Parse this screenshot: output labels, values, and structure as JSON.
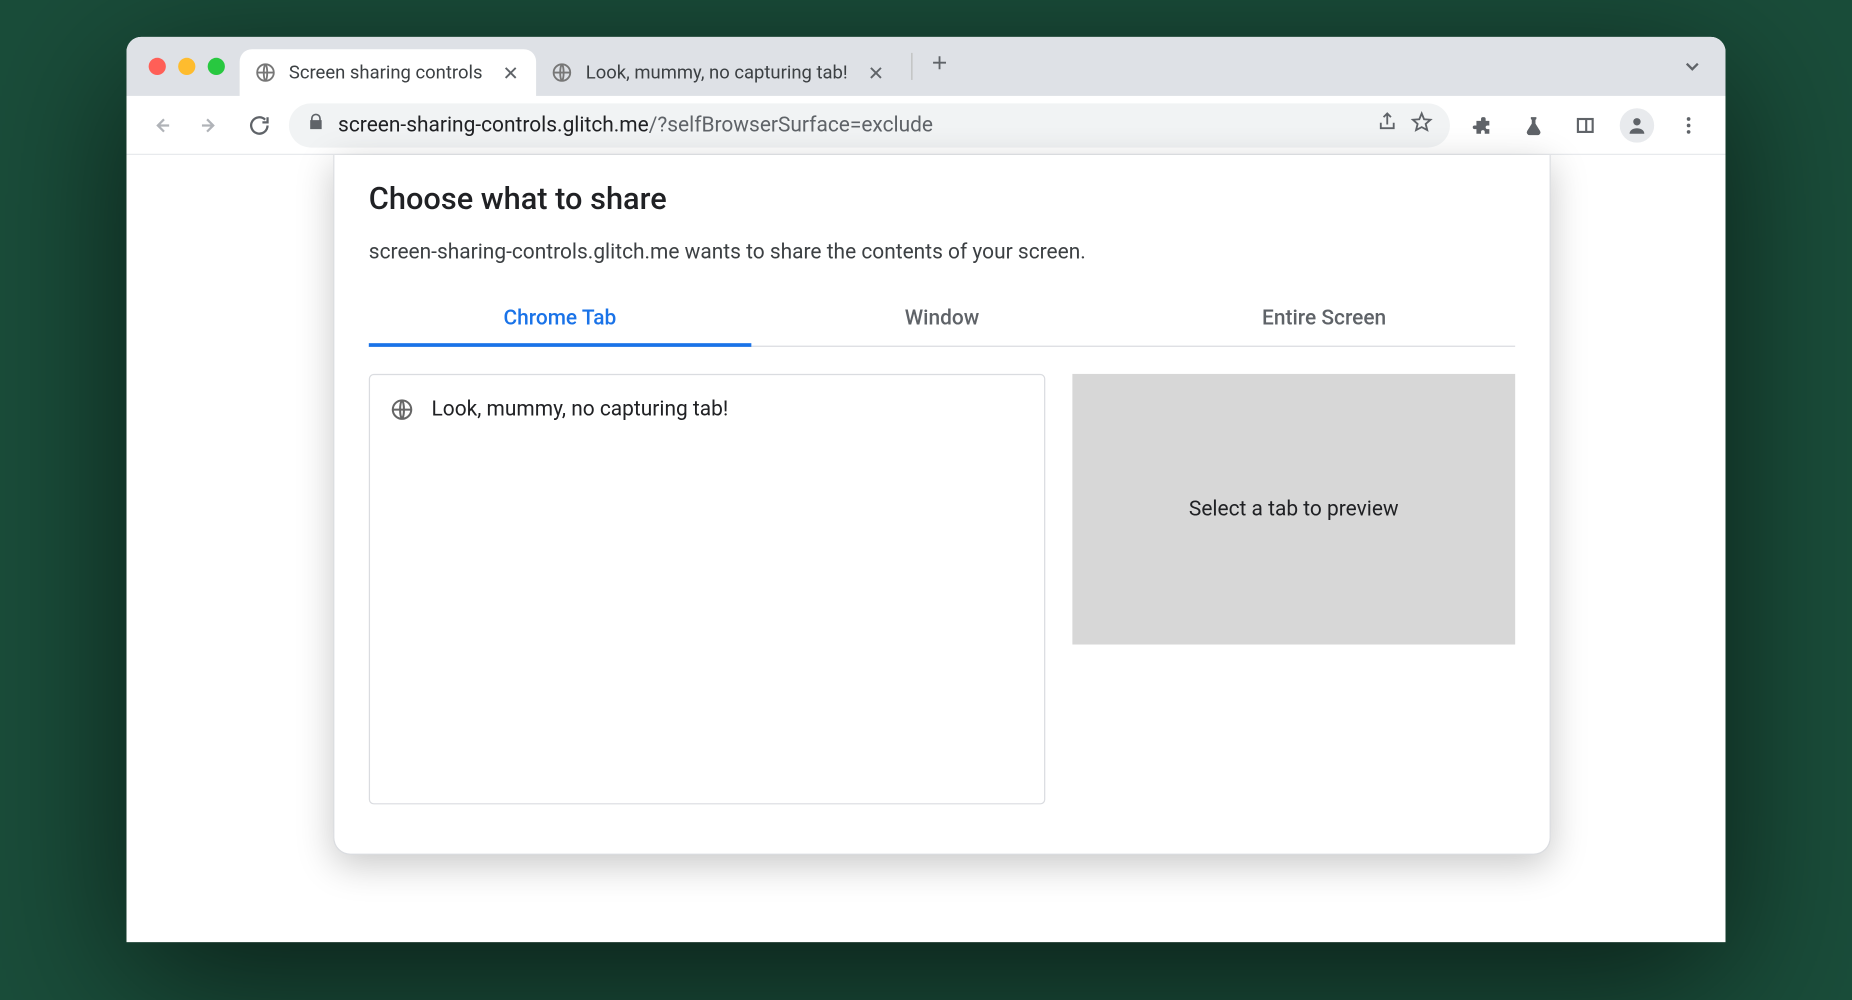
{
  "browser": {
    "tabs": [
      {
        "title": "Screen sharing controls",
        "active": true
      },
      {
        "title": "Look, mummy, no capturing tab!",
        "active": false
      }
    ],
    "url_host": "screen-sharing-controls.glitch.me",
    "url_path": "/?selfBrowserSurface=exclude"
  },
  "picker": {
    "title": "Choose what to share",
    "subtitle": "screen-sharing-controls.glitch.me wants to share the contents of your screen.",
    "tabs": [
      "Chrome Tab",
      "Window",
      "Entire Screen"
    ],
    "active_tab_index": 0,
    "tab_list": [
      {
        "title": "Look, mummy, no capturing tab!"
      }
    ],
    "preview_placeholder": "Select a tab to preview"
  },
  "colors": {
    "accent": "#1a73e8"
  }
}
